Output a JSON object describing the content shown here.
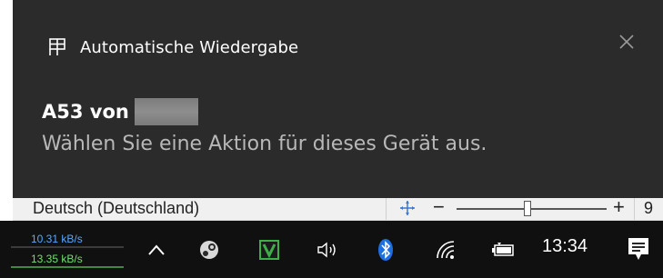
{
  "notification": {
    "app_name": "Automatische Wiedergabe",
    "title": "A53 von",
    "body": "Wählen Sie eine Aktion für dieses Gerät aus.",
    "app_icon": "autoplay-icon",
    "close_icon": "close-icon",
    "background": "#2b2b2b"
  },
  "language_bar": {
    "language": "Deutsch (Deutschland)",
    "minus": "−",
    "plus": "+",
    "zoom_partial": "9"
  },
  "taskbar": {
    "net_upload": "10.31 kB/s",
    "net_download": "13.35 kB/s",
    "time": "13:34",
    "tray_icons": [
      "chevron-up-icon",
      "steam-icon",
      "veeam-icon",
      "speaker-icon",
      "bluetooth-icon",
      "wifi-icon",
      "battery-icon",
      "action-center-icon"
    ]
  }
}
